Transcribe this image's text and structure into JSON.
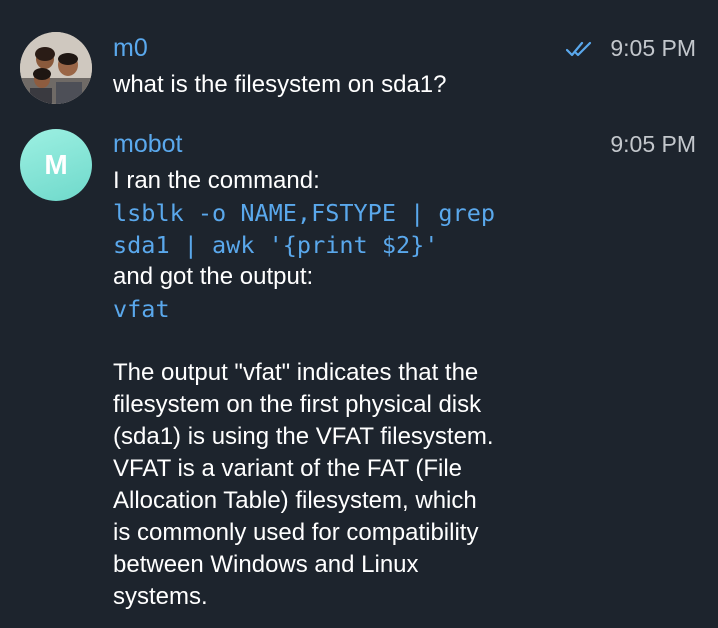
{
  "messages": [
    {
      "sender": "m0",
      "time": "9:05 PM",
      "text": "what is the filesystem on sda1?",
      "read_status": "double-check-icon"
    },
    {
      "sender": "mobot",
      "avatar_letter": "M",
      "time": "9:05 PM",
      "intro": "I ran the command:",
      "command_lines": [
        "lsblk -o NAME,FSTYPE | grep",
        "sda1 | awk '{print $2}'"
      ],
      "after_command": "and got the output:",
      "output": "vfat",
      "explanation_lines": [
        "The output \"vfat\" indicates that the",
        "filesystem on the first physical disk",
        "(sda1) is using the VFAT filesystem.",
        "VFAT is a variant of the FAT (File",
        "Allocation Table) filesystem, which",
        "is commonly used for compatibility",
        "between Windows and Linux",
        "systems."
      ]
    }
  ],
  "colors": {
    "background": "#1d242d",
    "accent": "#5aa8ec",
    "timestamp": "#c3c7cc",
    "avatar_bot": "#7fe3d5"
  }
}
